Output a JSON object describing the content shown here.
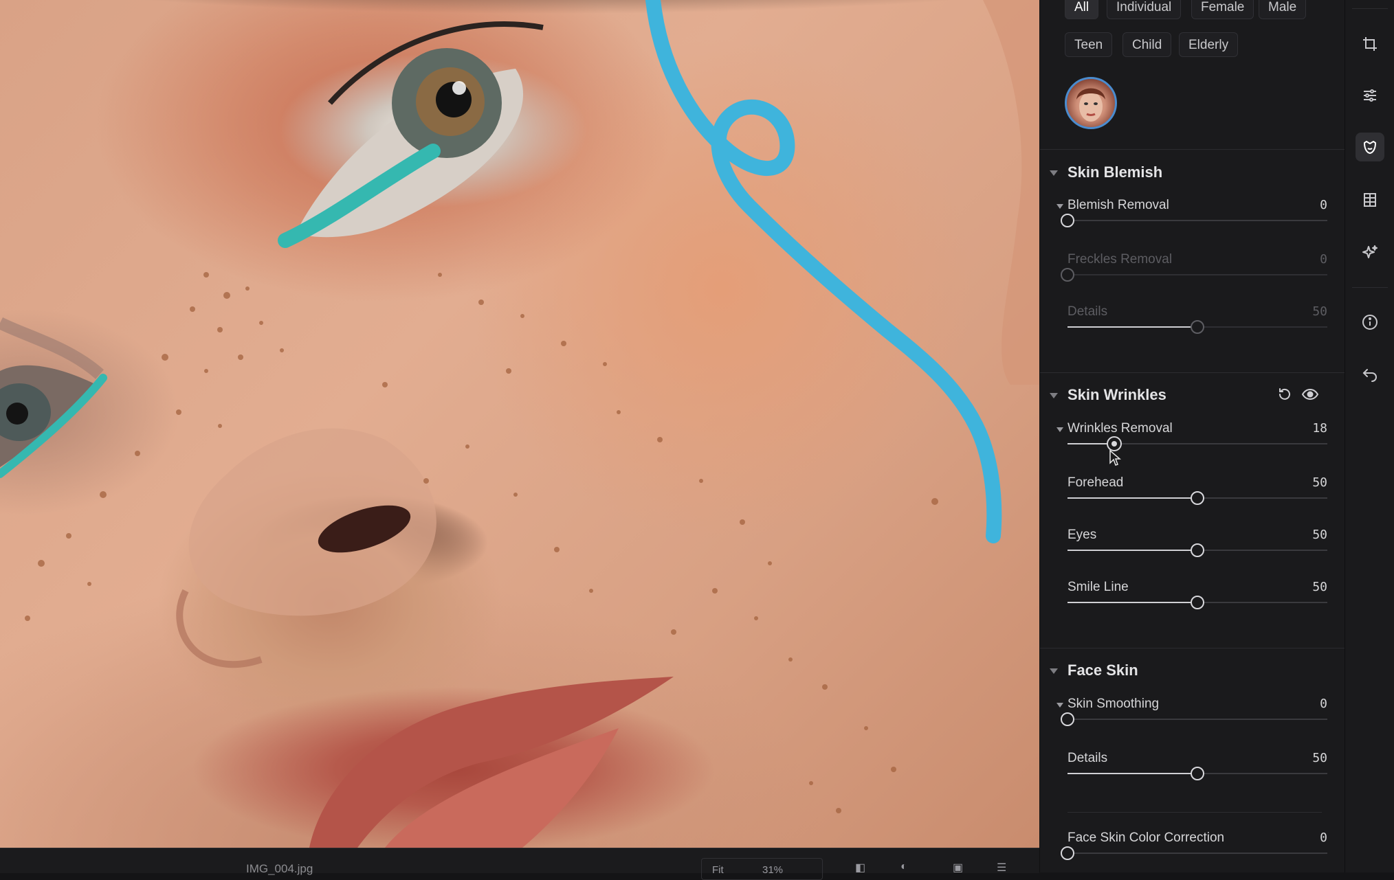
{
  "filters": {
    "chips_row1": [
      {
        "label": "All",
        "active": true
      },
      {
        "label": "Individual",
        "active": false
      },
      {
        "label": "Female",
        "active": false
      },
      {
        "label": "Male",
        "active": false
      }
    ],
    "chips_row2": [
      {
        "label": "Teen",
        "active": false
      },
      {
        "label": "Child",
        "active": false
      },
      {
        "label": "Elderly",
        "active": false
      }
    ]
  },
  "sections": {
    "skin_blemish": {
      "title": "Skin Blemish",
      "sliders": {
        "blemish_removal": {
          "label": "Blemish Removal",
          "value": "0",
          "level": 0
        },
        "freckles_removal": {
          "label": "Freckles Removal",
          "value": "0",
          "level": 0,
          "disabled": true
        },
        "details": {
          "label": "Details",
          "value": "50",
          "level": 0.5,
          "disabled": true
        }
      }
    },
    "skin_wrinkles": {
      "title": "Skin Wrinkles",
      "sliders": {
        "wrinkles_removal": {
          "label": "Wrinkles Removal",
          "value": "18",
          "level": 0.18
        },
        "forehead": {
          "label": "Forehead",
          "value": "50",
          "level": 0.5
        },
        "eyes": {
          "label": "Eyes",
          "value": "50",
          "level": 0.5
        },
        "smile_line": {
          "label": "Smile Line",
          "value": "50",
          "level": 0.5
        }
      }
    },
    "face_skin": {
      "title": "Face Skin",
      "sliders": {
        "skin_smoothing": {
          "label": "Skin Smoothing",
          "value": "0",
          "level": 0
        },
        "details": {
          "label": "Details",
          "value": "50",
          "level": 0.5
        },
        "color_correction": {
          "label": "Face Skin Color Correction",
          "value": "0",
          "level": 0
        }
      }
    }
  },
  "bottombar": {
    "filename": "IMG_004.jpg",
    "fit_label": "Fit",
    "zoom": "31%"
  },
  "icons": {
    "strip": [
      "crop-icon",
      "sliders-icon",
      "face-retouch-icon",
      "landscape-grid-icon",
      "sparkle-icon",
      "info-icon",
      "undo-history-icon"
    ],
    "section": [
      "reset-icon",
      "visibility-eye-icon"
    ]
  },
  "colors": {
    "accent_ring": "#4a8ccf",
    "paint_stroke": "#3fb4dc",
    "eyeliner": "#35b8b0"
  }
}
